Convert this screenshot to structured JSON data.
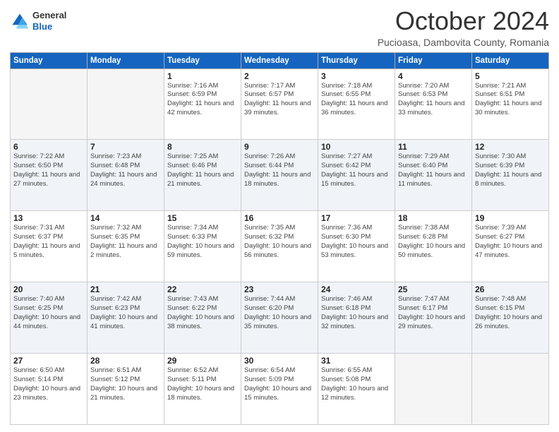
{
  "logo": {
    "general": "General",
    "blue": "Blue"
  },
  "header": {
    "month": "October 2024",
    "location": "Pucioasa, Dambovita County, Romania"
  },
  "weekdays": [
    "Sunday",
    "Monday",
    "Tuesday",
    "Wednesday",
    "Thursday",
    "Friday",
    "Saturday"
  ],
  "weeks": [
    [
      {
        "day": "",
        "detail": ""
      },
      {
        "day": "",
        "detail": ""
      },
      {
        "day": "1",
        "detail": "Sunrise: 7:16 AM\nSunset: 6:59 PM\nDaylight: 11 hours and 42 minutes."
      },
      {
        "day": "2",
        "detail": "Sunrise: 7:17 AM\nSunset: 6:57 PM\nDaylight: 11 hours and 39 minutes."
      },
      {
        "day": "3",
        "detail": "Sunrise: 7:18 AM\nSunset: 6:55 PM\nDaylight: 11 hours and 36 minutes."
      },
      {
        "day": "4",
        "detail": "Sunrise: 7:20 AM\nSunset: 6:53 PM\nDaylight: 11 hours and 33 minutes."
      },
      {
        "day": "5",
        "detail": "Sunrise: 7:21 AM\nSunset: 6:51 PM\nDaylight: 11 hours and 30 minutes."
      }
    ],
    [
      {
        "day": "6",
        "detail": "Sunrise: 7:22 AM\nSunset: 6:50 PM\nDaylight: 11 hours and 27 minutes."
      },
      {
        "day": "7",
        "detail": "Sunrise: 7:23 AM\nSunset: 6:48 PM\nDaylight: 11 hours and 24 minutes."
      },
      {
        "day": "8",
        "detail": "Sunrise: 7:25 AM\nSunset: 6:46 PM\nDaylight: 11 hours and 21 minutes."
      },
      {
        "day": "9",
        "detail": "Sunrise: 7:26 AM\nSunset: 6:44 PM\nDaylight: 11 hours and 18 minutes."
      },
      {
        "day": "10",
        "detail": "Sunrise: 7:27 AM\nSunset: 6:42 PM\nDaylight: 11 hours and 15 minutes."
      },
      {
        "day": "11",
        "detail": "Sunrise: 7:29 AM\nSunset: 6:40 PM\nDaylight: 11 hours and 11 minutes."
      },
      {
        "day": "12",
        "detail": "Sunrise: 7:30 AM\nSunset: 6:39 PM\nDaylight: 11 hours and 8 minutes."
      }
    ],
    [
      {
        "day": "13",
        "detail": "Sunrise: 7:31 AM\nSunset: 6:37 PM\nDaylight: 11 hours and 5 minutes."
      },
      {
        "day": "14",
        "detail": "Sunrise: 7:32 AM\nSunset: 6:35 PM\nDaylight: 11 hours and 2 minutes."
      },
      {
        "day": "15",
        "detail": "Sunrise: 7:34 AM\nSunset: 6:33 PM\nDaylight: 10 hours and 59 minutes."
      },
      {
        "day": "16",
        "detail": "Sunrise: 7:35 AM\nSunset: 6:32 PM\nDaylight: 10 hours and 56 minutes."
      },
      {
        "day": "17",
        "detail": "Sunrise: 7:36 AM\nSunset: 6:30 PM\nDaylight: 10 hours and 53 minutes."
      },
      {
        "day": "18",
        "detail": "Sunrise: 7:38 AM\nSunset: 6:28 PM\nDaylight: 10 hours and 50 minutes."
      },
      {
        "day": "19",
        "detail": "Sunrise: 7:39 AM\nSunset: 6:27 PM\nDaylight: 10 hours and 47 minutes."
      }
    ],
    [
      {
        "day": "20",
        "detail": "Sunrise: 7:40 AM\nSunset: 6:25 PM\nDaylight: 10 hours and 44 minutes."
      },
      {
        "day": "21",
        "detail": "Sunrise: 7:42 AM\nSunset: 6:23 PM\nDaylight: 10 hours and 41 minutes."
      },
      {
        "day": "22",
        "detail": "Sunrise: 7:43 AM\nSunset: 6:22 PM\nDaylight: 10 hours and 38 minutes."
      },
      {
        "day": "23",
        "detail": "Sunrise: 7:44 AM\nSunset: 6:20 PM\nDaylight: 10 hours and 35 minutes."
      },
      {
        "day": "24",
        "detail": "Sunrise: 7:46 AM\nSunset: 6:18 PM\nDaylight: 10 hours and 32 minutes."
      },
      {
        "day": "25",
        "detail": "Sunrise: 7:47 AM\nSunset: 6:17 PM\nDaylight: 10 hours and 29 minutes."
      },
      {
        "day": "26",
        "detail": "Sunrise: 7:48 AM\nSunset: 6:15 PM\nDaylight: 10 hours and 26 minutes."
      }
    ],
    [
      {
        "day": "27",
        "detail": "Sunrise: 6:50 AM\nSunset: 5:14 PM\nDaylight: 10 hours and 23 minutes."
      },
      {
        "day": "28",
        "detail": "Sunrise: 6:51 AM\nSunset: 5:12 PM\nDaylight: 10 hours and 21 minutes."
      },
      {
        "day": "29",
        "detail": "Sunrise: 6:52 AM\nSunset: 5:11 PM\nDaylight: 10 hours and 18 minutes."
      },
      {
        "day": "30",
        "detail": "Sunrise: 6:54 AM\nSunset: 5:09 PM\nDaylight: 10 hours and 15 minutes."
      },
      {
        "day": "31",
        "detail": "Sunrise: 6:55 AM\nSunset: 5:08 PM\nDaylight: 10 hours and 12 minutes."
      },
      {
        "day": "",
        "detail": ""
      },
      {
        "day": "",
        "detail": ""
      }
    ]
  ]
}
